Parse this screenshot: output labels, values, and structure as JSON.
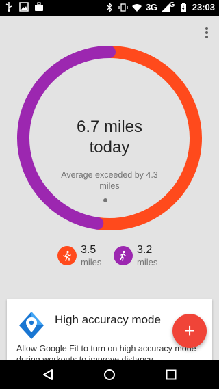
{
  "status_bar": {
    "network": "3G",
    "signal_label": "G",
    "time": "23:03",
    "icons": [
      "usb-icon",
      "image-icon",
      "briefcase-icon",
      "bluetooth-icon",
      "vibrate-icon",
      "wifi-icon",
      "signal-icon",
      "battery-charging-icon"
    ]
  },
  "menu": {
    "icon": "more-vert-icon"
  },
  "summary": {
    "line1": "6.7 miles",
    "line2": "today",
    "subtitle": "Average exceeded by 4.3 miles",
    "ring": {
      "segments": [
        {
          "activity": "running",
          "color": "#ff4a1c",
          "miles": 3.5
        },
        {
          "activity": "walking",
          "color": "#9c27b0",
          "miles": 3.2
        }
      ]
    }
  },
  "stats": [
    {
      "activity": "running",
      "icon": "running-icon",
      "value": "3.5",
      "unit": "miles",
      "color": "#ff4a1c"
    },
    {
      "activity": "walking",
      "icon": "walking-icon",
      "value": "3.2",
      "unit": "miles",
      "color": "#9c27b0"
    }
  ],
  "card": {
    "icon": "location-pin-icon",
    "title": "High accuracy mode",
    "body": "Allow Google Fit to turn on high accuracy mode during workouts to improve distance"
  },
  "fab": {
    "label": "+",
    "icon": "add-icon",
    "color": "#f04438"
  },
  "nav": {
    "icons": [
      "back-icon",
      "home-icon",
      "recents-icon"
    ]
  }
}
